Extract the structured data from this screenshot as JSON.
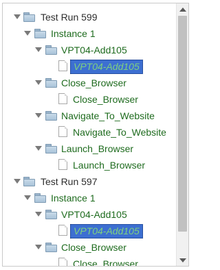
{
  "tree": {
    "nodes": [
      {
        "label": "Test Run 599",
        "icon": "folder-icon",
        "toggle": "expanded",
        "style": "dark"
      },
      {
        "label": "Instance 1",
        "icon": "folder-icon",
        "toggle": "expanded",
        "style": "normal"
      },
      {
        "label": "VPT04-Add105",
        "icon": "folder-icon",
        "toggle": "expanded",
        "style": "normal"
      },
      {
        "label": "VPT04-Add105",
        "icon": "file-icon",
        "toggle": "none",
        "style": "selected"
      },
      {
        "label": "Close_Browser",
        "icon": "folder-icon",
        "toggle": "expanded",
        "style": "normal"
      },
      {
        "label": "Close_Browser",
        "icon": "file-icon",
        "toggle": "none",
        "style": "normal"
      },
      {
        "label": "Navigate_To_Website",
        "icon": "folder-icon",
        "toggle": "expanded",
        "style": "normal"
      },
      {
        "label": "Navigate_To_Website",
        "icon": "file-icon",
        "toggle": "none",
        "style": "normal"
      },
      {
        "label": "Launch_Browser",
        "icon": "folder-icon",
        "toggle": "expanded",
        "style": "normal"
      },
      {
        "label": "Launch_Browser",
        "icon": "file-icon",
        "toggle": "none",
        "style": "normal"
      },
      {
        "label": "Test Run 597",
        "icon": "folder-icon",
        "toggle": "expanded",
        "style": "dark"
      },
      {
        "label": "Instance 1",
        "icon": "folder-icon",
        "toggle": "expanded",
        "style": "normal"
      },
      {
        "label": "VPT04-Add105",
        "icon": "folder-icon",
        "toggle": "expanded",
        "style": "normal"
      },
      {
        "label": "VPT04-Add105",
        "icon": "file-icon",
        "toggle": "none",
        "style": "selected"
      },
      {
        "label": "Close_Browser",
        "icon": "folder-icon",
        "toggle": "expanded",
        "style": "normal"
      },
      {
        "label": "Close_Browser",
        "icon": "file-icon",
        "toggle": "none",
        "style": "normal"
      }
    ]
  },
  "scrollbar": {
    "up_icon": "chevron-up-icon",
    "down_icon": "chevron-down-icon"
  },
  "colors": {
    "label_green": "#1e6b1e",
    "selected_bg": "#3d6fd1",
    "selected_text": "#7fd17f"
  }
}
